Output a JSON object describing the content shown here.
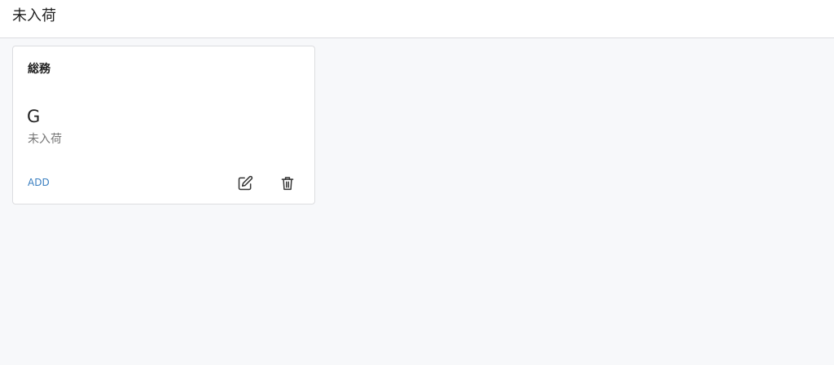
{
  "header": {
    "title": "未入荷"
  },
  "card": {
    "category": "総務",
    "name": "G",
    "status": "未入荷",
    "add_label": "ADD",
    "edit_icon": "edit-icon",
    "delete_icon": "trash-icon"
  },
  "colors": {
    "accent": "#3a7fc0",
    "background": "#f7f8fa",
    "card_border": "#dcdde0",
    "muted_text": "#757575"
  }
}
